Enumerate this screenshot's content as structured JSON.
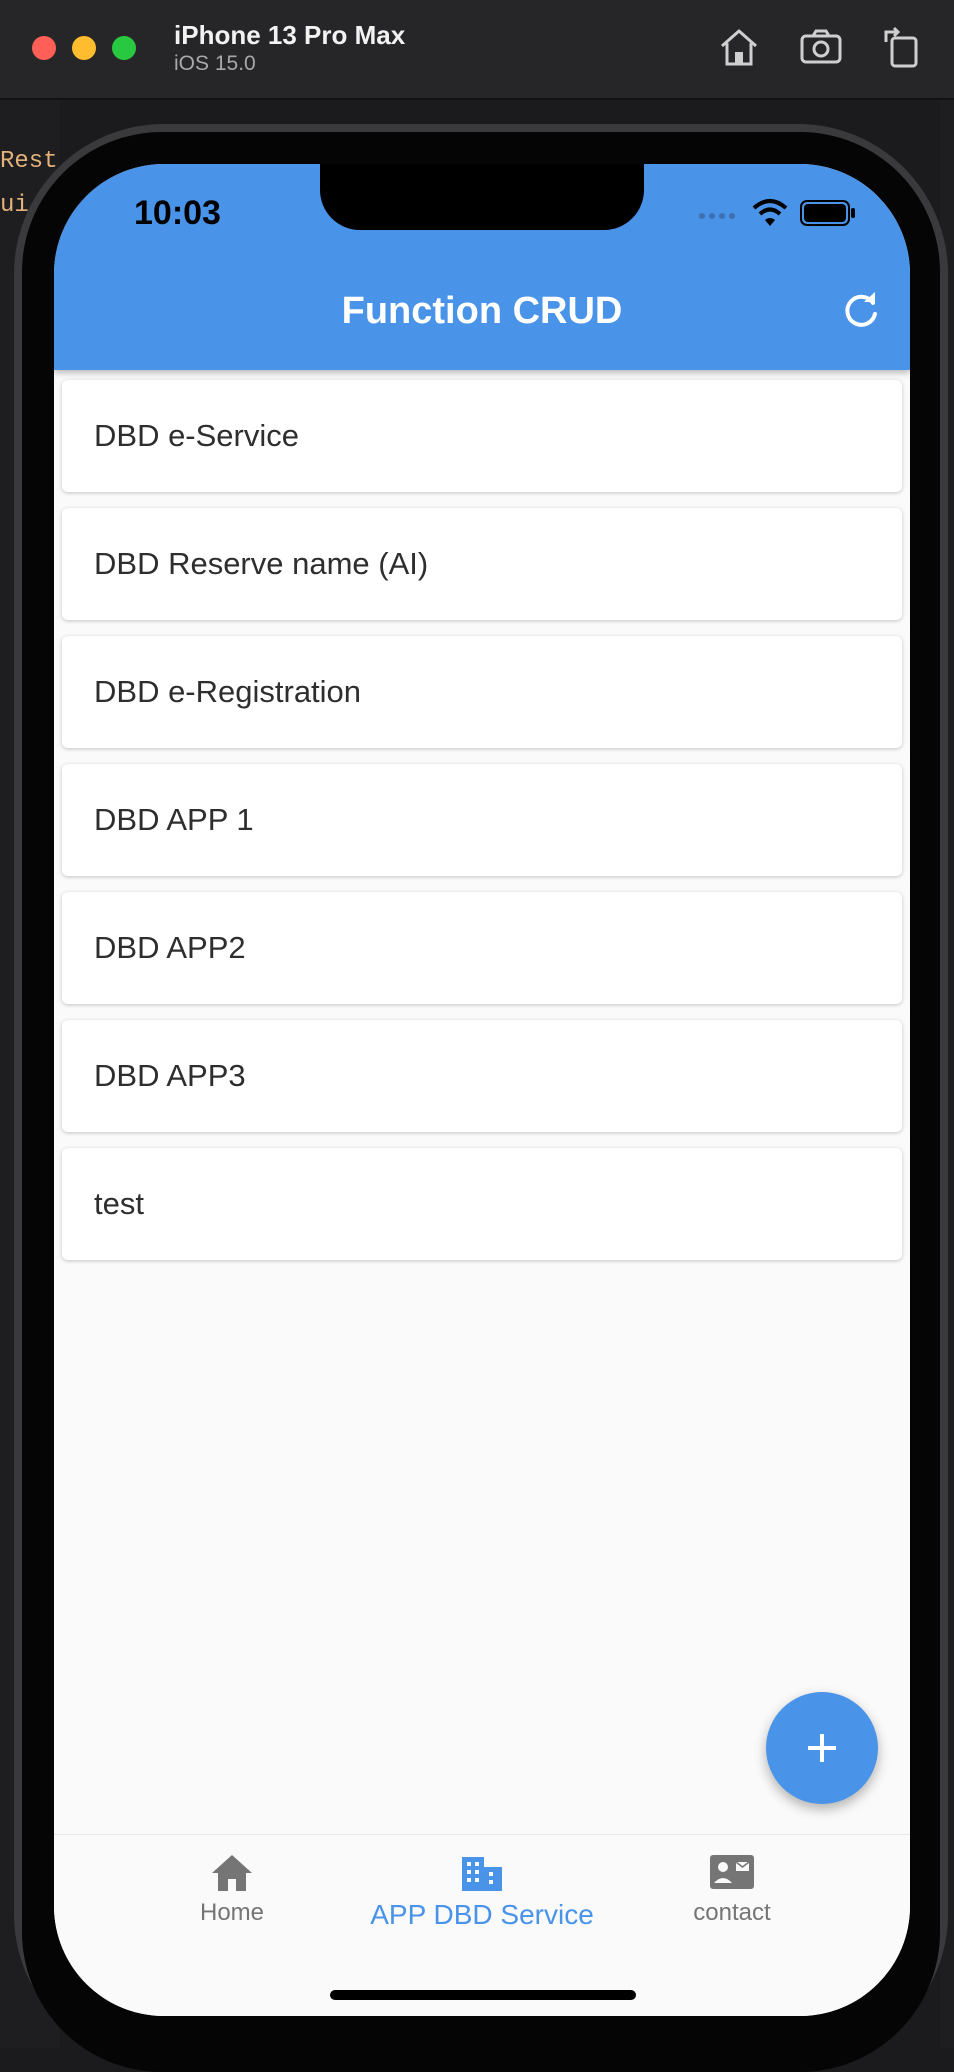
{
  "simulator": {
    "device_name": "iPhone 13 Pro Max",
    "os_version": "iOS 15.0",
    "icons": [
      "home-icon",
      "screenshot-icon",
      "rotate-icon"
    ]
  },
  "status_bar": {
    "time": "10:03"
  },
  "app_bar": {
    "title": "Function CRUD",
    "action_icon": "refresh-icon"
  },
  "services": [
    {
      "label": "DBD e-Service"
    },
    {
      "label": "DBD Reserve name (AI)"
    },
    {
      "label": "DBD e-Registration"
    },
    {
      "label": "DBD APP 1"
    },
    {
      "label": "DBD APP2"
    },
    {
      "label": "DBD APP3"
    },
    {
      "label": "test"
    }
  ],
  "fab": {
    "icon": "plus-icon"
  },
  "bottom_nav": {
    "items": [
      {
        "label": "Home",
        "icon": "home-icon"
      },
      {
        "label": "APP DBD Service",
        "icon": "building-icon",
        "active": true
      },
      {
        "label": "contact",
        "icon": "contact-card-icon"
      }
    ]
  },
  "background_editor": {
    "fragments": [
      "Rest",
      "ui-"
    ]
  },
  "colors": {
    "primary": "#4993e8",
    "background": "#fafafa",
    "inactive": "#757575"
  }
}
